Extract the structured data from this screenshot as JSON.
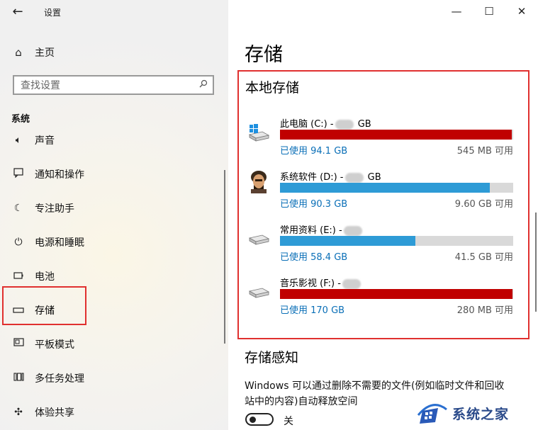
{
  "window": {
    "title": "设置"
  },
  "sidebar": {
    "home_label": "主页",
    "search_placeholder": "查找设置",
    "section": "系统",
    "items": [
      {
        "label": "声音",
        "icon": "speaker-icon"
      },
      {
        "label": "通知和操作",
        "icon": "message-icon"
      },
      {
        "label": "专注助手",
        "icon": "moon-icon"
      },
      {
        "label": "电源和睡眠",
        "icon": "power-icon"
      },
      {
        "label": "电池",
        "icon": "battery-icon"
      },
      {
        "label": "存储",
        "icon": "storage-icon",
        "selected": true
      },
      {
        "label": "平板模式",
        "icon": "tablet-icon"
      },
      {
        "label": "多任务处理",
        "icon": "multitask-icon"
      },
      {
        "label": "体验共享",
        "icon": "share-icon"
      }
    ]
  },
  "main": {
    "title": "存储",
    "local_title": "本地存储",
    "drives": [
      {
        "name": "此电脑 (C:) -",
        "size_suffix": "GB",
        "used": "已使用 94.1 GB",
        "free": "545 MB 可用",
        "fill_fraction": 0.995,
        "fill_color": "#c00000",
        "icon": "windows-drive-icon"
      },
      {
        "name": "系统软件 (D:) -",
        "size_suffix": "GB",
        "used": "已使用 90.3 GB",
        "free": "9.60 GB 可用",
        "fill_fraction": 0.9,
        "fill_color": "#2e9bd6",
        "icon": "avatar-drive-icon"
      },
      {
        "name": "常用资料 (E:) -",
        "size_suffix": "",
        "used": "已使用 58.4 GB",
        "free": "41.5 GB 可用",
        "fill_fraction": 0.58,
        "fill_color": "#2e9bd6",
        "icon": "drive-icon"
      },
      {
        "name": "音乐影视 (F:) -",
        "size_suffix": "",
        "used": "已使用 170 GB",
        "free": "280 MB 可用",
        "fill_fraction": 0.998,
        "fill_color": "#c00000",
        "icon": "drive-icon"
      }
    ],
    "sense_title": "存储感知",
    "sense_desc": "Windows 可以通过删除不需要的文件(例如临时文件和回收站中的内容)自动释放空间",
    "toggle_label": "关"
  },
  "watermark": {
    "text": "系统之家"
  }
}
